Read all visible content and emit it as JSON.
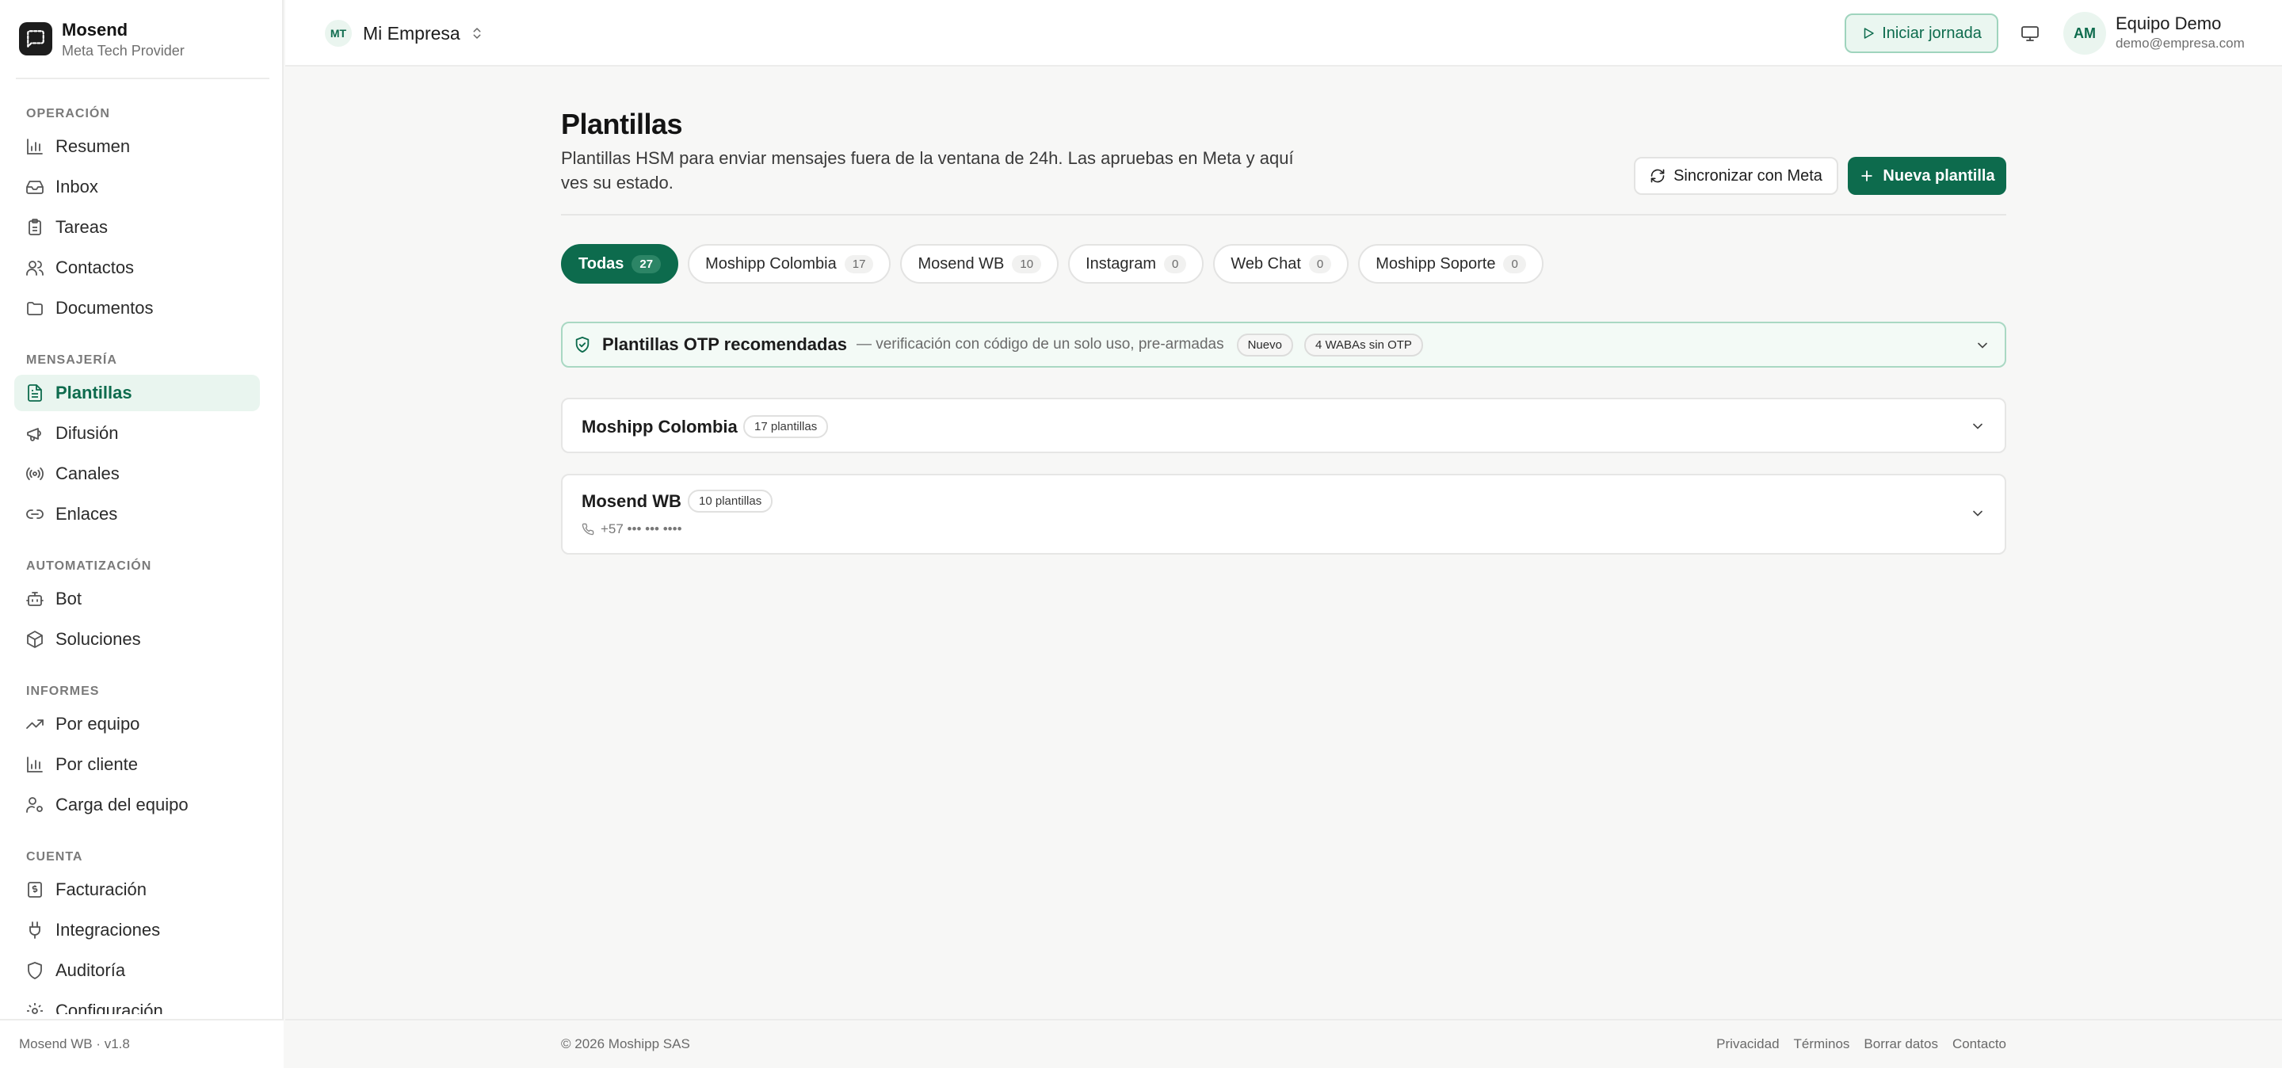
{
  "brand": {
    "name": "Mosend",
    "subtitle": "Meta Tech Provider"
  },
  "sidebar": {
    "sections": [
      {
        "label": "OPERACIÓN",
        "items": [
          {
            "label": "Resumen",
            "icon": "bar-chart-icon"
          },
          {
            "label": "Inbox",
            "icon": "inbox-icon"
          },
          {
            "label": "Tareas",
            "icon": "clipboard-icon"
          },
          {
            "label": "Contactos",
            "icon": "users-icon"
          },
          {
            "label": "Documentos",
            "icon": "folder-icon"
          }
        ]
      },
      {
        "label": "MENSAJERÍA",
        "items": [
          {
            "label": "Plantillas",
            "icon": "file-text-icon",
            "active": true
          },
          {
            "label": "Difusión",
            "icon": "megaphone-icon"
          },
          {
            "label": "Canales",
            "icon": "radio-icon"
          },
          {
            "label": "Enlaces",
            "icon": "link-icon"
          }
        ]
      },
      {
        "label": "AUTOMATIZACIÓN",
        "items": [
          {
            "label": "Bot",
            "icon": "bot-icon"
          },
          {
            "label": "Soluciones",
            "icon": "package-icon"
          }
        ]
      },
      {
        "label": "INFORMES",
        "items": [
          {
            "label": "Por equipo",
            "icon": "trending-up-icon"
          },
          {
            "label": "Por cliente",
            "icon": "bar-chart-icon"
          },
          {
            "label": "Carga del equipo",
            "icon": "user-cog-icon"
          }
        ]
      },
      {
        "label": "CUENTA",
        "items": [
          {
            "label": "Facturación",
            "icon": "receipt-icon"
          },
          {
            "label": "Integraciones",
            "icon": "plug-icon"
          },
          {
            "label": "Auditoría",
            "icon": "shield-icon"
          },
          {
            "label": "Configuración",
            "icon": "gear-icon"
          }
        ]
      }
    ],
    "footer": "Mosend WB · v1.8"
  },
  "topbar": {
    "org_initials": "MT",
    "org_name": "Mi Empresa",
    "start_shift": "Iniciar jornada",
    "user_initials": "AM",
    "user_name": "Equipo Demo",
    "user_email": "demo@empresa.com"
  },
  "page": {
    "title": "Plantillas",
    "description": "Plantillas HSM para enviar mensajes fuera de la ventana de 24h. Las apruebas en Meta y aquí ves su estado.",
    "sync_button": "Sincronizar con Meta",
    "new_button": "Nueva plantilla"
  },
  "tabs": [
    {
      "label": "Todas",
      "count": "27",
      "active": true
    },
    {
      "label": "Moshipp Colombia",
      "count": "17"
    },
    {
      "label": "Mosend WB",
      "count": "10"
    },
    {
      "label": "Instagram",
      "count": "0"
    },
    {
      "label": "Web Chat",
      "count": "0"
    },
    {
      "label": "Moshipp Soporte",
      "count": "0"
    }
  ],
  "otp": {
    "title": "Plantillas OTP recomendadas",
    "subtitle": "— verificación con código de un solo uso, pre-armadas",
    "badge_new": "Nuevo",
    "badge_wabas": "4 WABAs sin OTP"
  },
  "groups": [
    {
      "name": "Moshipp Colombia",
      "count_label": "17 plantillas"
    },
    {
      "name": "Mosend WB",
      "count_label": "10 plantillas",
      "phone": "+57 ••• ••• ••••"
    }
  ],
  "footer": {
    "copyright": "© 2026 Moshipp SAS",
    "links": [
      "Privacidad",
      "Términos",
      "Borrar datos",
      "Contacto"
    ]
  },
  "colors": {
    "accent": "#0d6b4d",
    "accent_light": "#e9f5ef",
    "border": "#e6e6e5"
  }
}
